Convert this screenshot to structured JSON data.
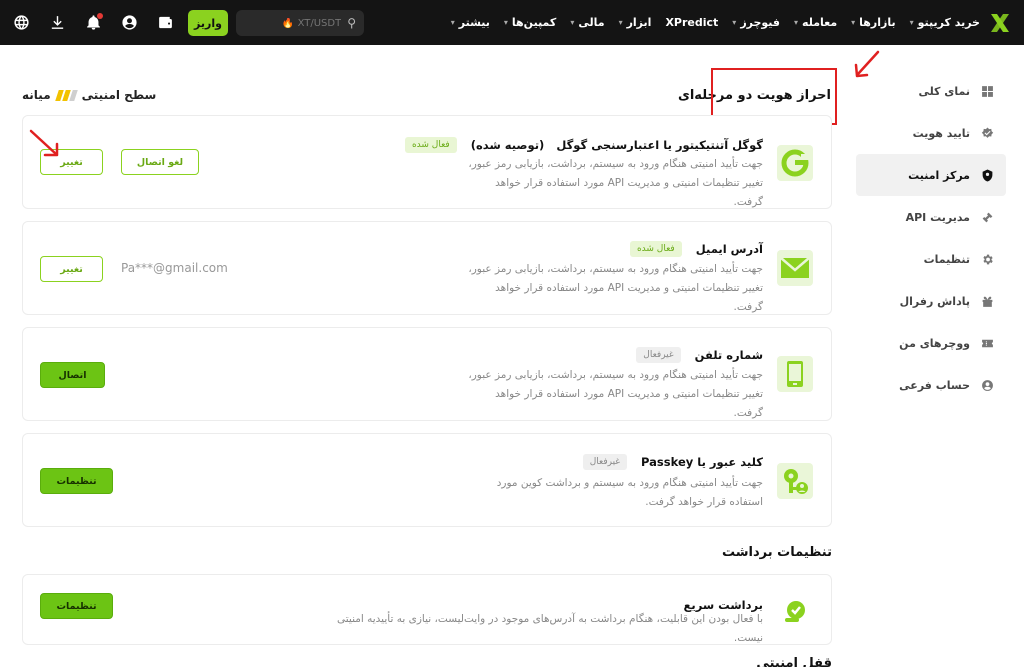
{
  "topbar": {
    "nav": [
      {
        "label": "خرید کریپتو",
        "chevron": true
      },
      {
        "label": "بازارها",
        "chevron": true
      },
      {
        "label": "معامله",
        "chevron": true
      },
      {
        "label": "فیوچرز",
        "chevron": true
      },
      {
        "label": "XPredict",
        "chevron": false
      },
      {
        "label": "ابزار",
        "chevron": true
      },
      {
        "label": "مالی",
        "chevron": true
      },
      {
        "label": "کمپین‌ها",
        "chevron": true
      },
      {
        "label": "بیشتر",
        "chevron": true
      }
    ],
    "search_placeholder": "XT/USDT 🔥",
    "deposit_label": "واریز",
    "icons": [
      "globe-icon",
      "download-icon",
      "bell-icon",
      "user-icon",
      "wallet-icon"
    ]
  },
  "sidebar": {
    "items": [
      {
        "label": "نمای کلی",
        "icon": "grid-icon",
        "active": false
      },
      {
        "label": "تایید هویت",
        "icon": "verified-icon",
        "active": false
      },
      {
        "label": "مرکز امنیت",
        "icon": "shield-icon",
        "active": true
      },
      {
        "label": "مدیریت API",
        "icon": "api-icon",
        "active": false
      },
      {
        "label": "تنظیمات",
        "icon": "gear-icon",
        "active": false
      },
      {
        "label": "پاداش رفرال",
        "icon": "gift-icon",
        "active": false
      },
      {
        "label": "ووچرهای من",
        "icon": "voucher-icon",
        "active": false
      },
      {
        "label": "حساب فرعی",
        "icon": "sub-account-icon",
        "active": false
      }
    ]
  },
  "main": {
    "twofa_title": "احراز هویت دو مرحله‌ای",
    "security_level_label": "سطح امنیتی",
    "security_level_value": "میانه",
    "security_level_bars": 3,
    "security_level_filled": 2,
    "cards": [
      {
        "title": "گوگل آتنتیکیتور یا اعتبارسنجی گوگل",
        "title_suffix": "(توصیه شده)",
        "badge": "فعال شده",
        "badge_state": "on",
        "desc": "جهت تأیید امنیتی هنگام ورود به سیستم، برداشت، بازیابی رمز عبور، تغییر تنظیمات امنیتی و مدیریت API مورد استفاده قرار خواهد گرفت.",
        "buttons": [
          "لغو اتصال",
          "تغییر"
        ],
        "icon": "google-auth-icon"
      },
      {
        "title": "آدرس ایمیل",
        "badge": "فعال شده",
        "badge_state": "on",
        "value": "Pa***@gmail.com",
        "desc": "جهت تأیید امنیتی هنگام ورود به سیستم، برداشت، بازیابی رمز عبور، تغییر تنظیمات امنیتی و مدیریت API مورد استفاده قرار خواهد گرفت.",
        "buttons": [
          "تغییر"
        ],
        "icon": "email-icon"
      },
      {
        "title": "شماره تلفن",
        "badge": "غیرفعال",
        "badge_state": "off",
        "desc": "جهت تأیید امنیتی هنگام ورود به سیستم، برداشت، بازیابی رمز عبور، تغییر تنظیمات امنیتی و مدیریت API مورد استفاده قرار خواهد گرفت.",
        "buttons": [
          "اتصال"
        ],
        "icon": "phone-icon"
      },
      {
        "title": "کلید عبور یا Passkey",
        "badge": "غیرفعال",
        "badge_state": "off",
        "desc": "جهت تأیید امنیتی هنگام ورود به سیستم و برداشت کوین مورد استفاده قرار خواهد گرفت.",
        "buttons": [
          "تنظیمات"
        ],
        "icon": "passkey-icon"
      }
    ],
    "withdraw_title": "تنظیمات برداشت",
    "withdraw_card": {
      "title": "برداشت سریع",
      "desc": "با فعال بودن این قابلیت، هنگام برداشت به آدرس‌های موجود در وایت‌لیست، نیازی به تأییدیه امنیتی نیست.",
      "button": "تنظیمات",
      "icon": "fast-withdraw-icon"
    },
    "next_title_partial": "قفل امنیتی"
  },
  "colors": {
    "brand": "#8bd21f",
    "topbar": "#141414",
    "annotation_red": "#e02020",
    "level_filled": "#f2c200",
    "level_empty": "#cfcfcf"
  }
}
